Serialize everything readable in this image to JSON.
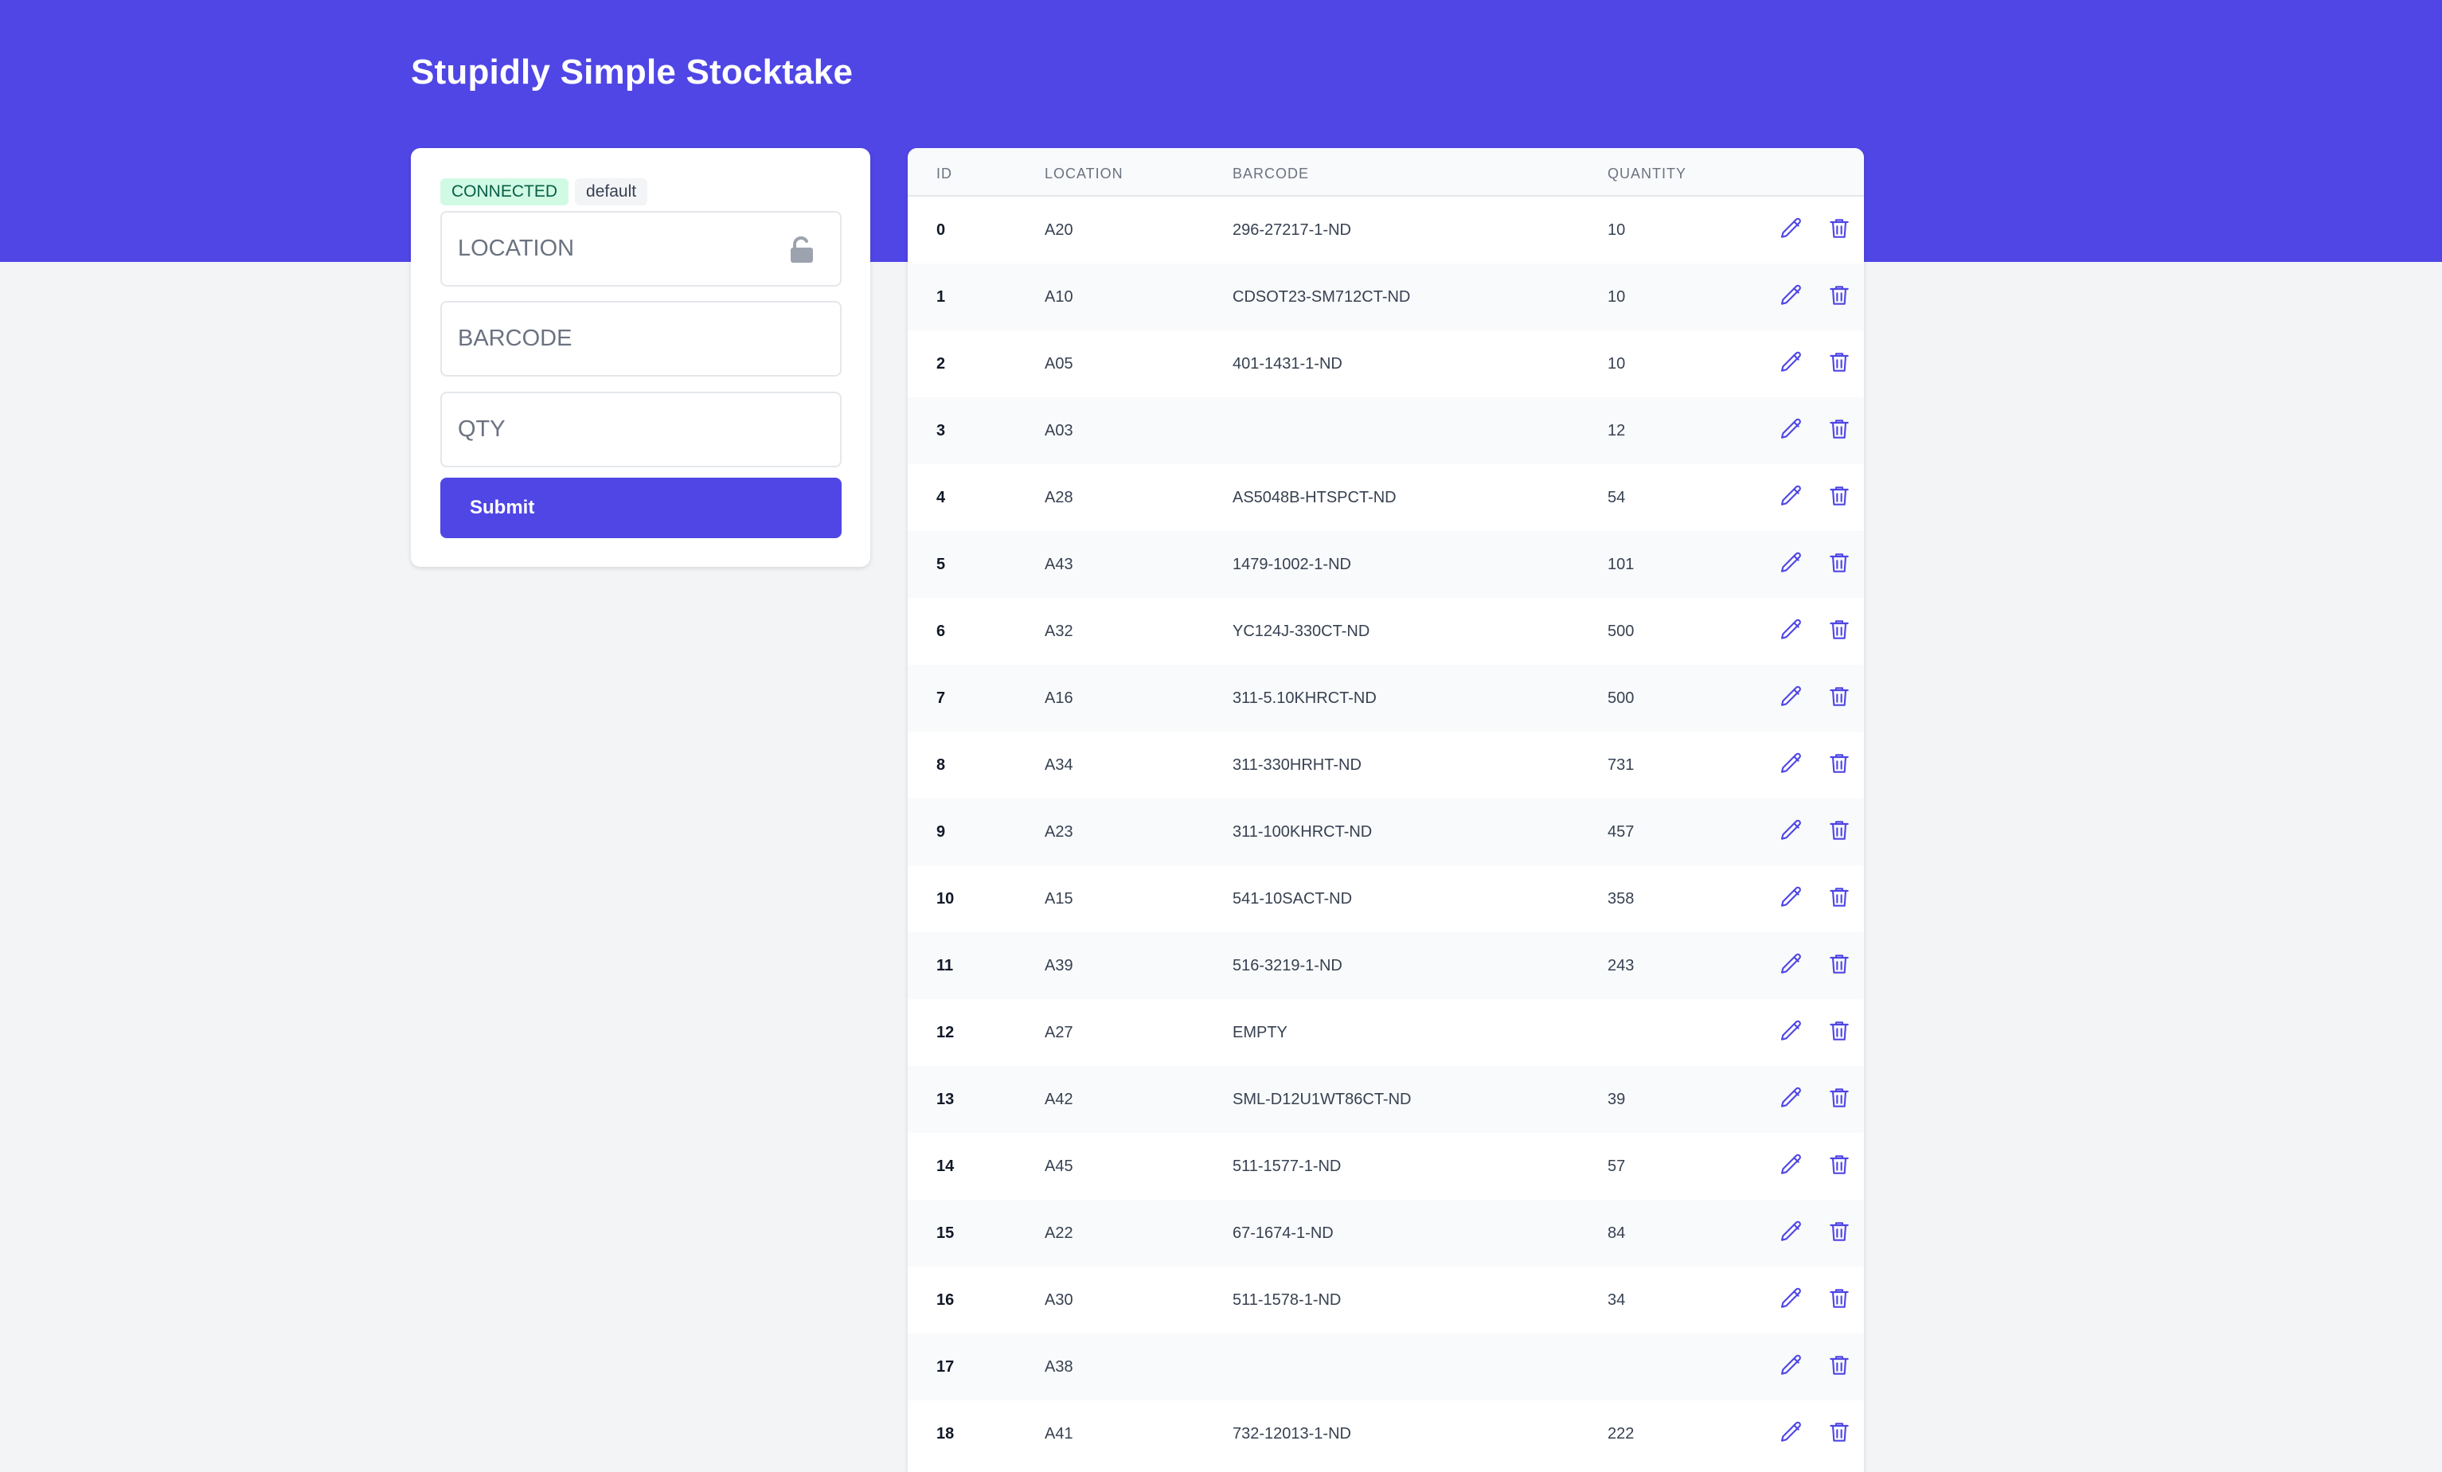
{
  "app": {
    "title": "Stupidly Simple Stocktake"
  },
  "status": {
    "connection": "CONNECTED",
    "profile": "default"
  },
  "form": {
    "location_placeholder": "LOCATION",
    "barcode_placeholder": "BARCODE",
    "qty_placeholder": "QTY",
    "submit_label": "Submit",
    "location_lock_icon": "unlocked-padlock-icon"
  },
  "colors": {
    "accent": "#4f46e5",
    "connected_bg": "#d1fae5",
    "connected_text": "#065f46"
  },
  "table": {
    "columns": [
      "ID",
      "LOCATION",
      "BARCODE",
      "QUANTITY"
    ],
    "row_actions": [
      "pencil-icon",
      "trash-icon"
    ],
    "rows": [
      {
        "id": "0",
        "location": "A20",
        "barcode": "296-27217-1-ND",
        "quantity": "10"
      },
      {
        "id": "1",
        "location": "A10",
        "barcode": "CDSOT23-SM712CT-ND",
        "quantity": "10"
      },
      {
        "id": "2",
        "location": "A05",
        "barcode": "401-1431-1-ND",
        "quantity": "10"
      },
      {
        "id": "3",
        "location": "A03",
        "barcode": "",
        "quantity": "12"
      },
      {
        "id": "4",
        "location": "A28",
        "barcode": "AS5048B-HTSPCT-ND",
        "quantity": "54"
      },
      {
        "id": "5",
        "location": "A43",
        "barcode": "1479-1002-1-ND",
        "quantity": "101"
      },
      {
        "id": "6",
        "location": "A32",
        "barcode": "YC124J-330CT-ND",
        "quantity": "500"
      },
      {
        "id": "7",
        "location": "A16",
        "barcode": "311-5.10KHRCT-ND",
        "quantity": "500"
      },
      {
        "id": "8",
        "location": "A34",
        "barcode": "311-330HRHT-ND",
        "quantity": "731"
      },
      {
        "id": "9",
        "location": "A23",
        "barcode": "311-100KHRCT-ND",
        "quantity": "457"
      },
      {
        "id": "10",
        "location": "A15",
        "barcode": "541-10SACT-ND",
        "quantity": "358"
      },
      {
        "id": "11",
        "location": "A39",
        "barcode": "516-3219-1-ND",
        "quantity": "243"
      },
      {
        "id": "12",
        "location": "A27",
        "barcode": "EMPTY",
        "quantity": ""
      },
      {
        "id": "13",
        "location": "A42",
        "barcode": "SML-D12U1WT86CT-ND",
        "quantity": "39"
      },
      {
        "id": "14",
        "location": "A45",
        "barcode": "511-1577-1-ND",
        "quantity": "57"
      },
      {
        "id": "15",
        "location": "A22",
        "barcode": "67-1674-1-ND",
        "quantity": "84"
      },
      {
        "id": "16",
        "location": "A30",
        "barcode": "511-1578-1-ND",
        "quantity": "34"
      },
      {
        "id": "17",
        "location": "A38",
        "barcode": "",
        "quantity": ""
      },
      {
        "id": "18",
        "location": "A41",
        "barcode": "732-12013-1-ND",
        "quantity": "222"
      }
    ]
  }
}
